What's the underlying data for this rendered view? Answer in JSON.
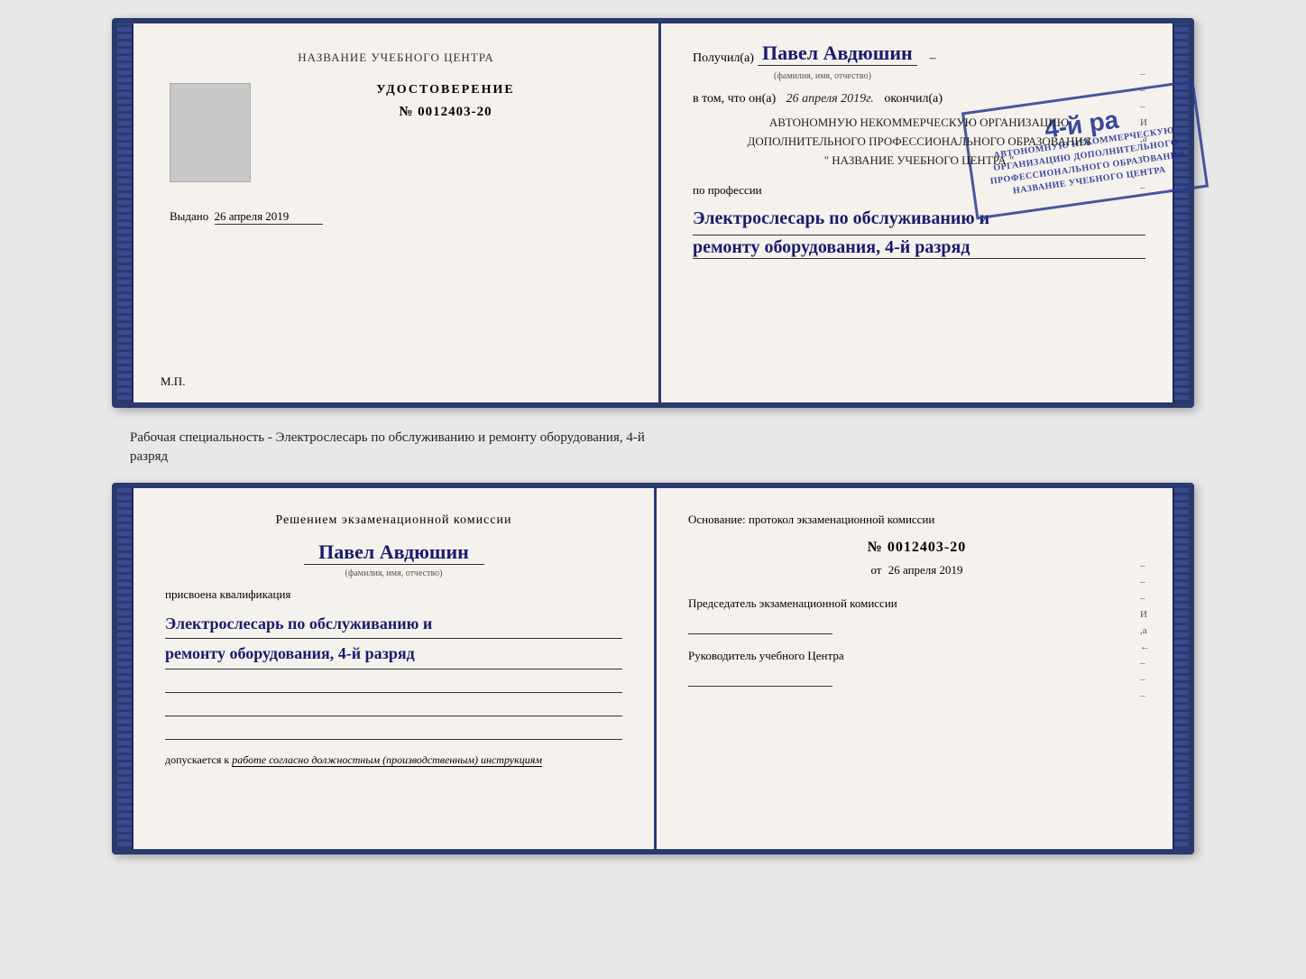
{
  "top_book": {
    "left_page": {
      "org_label": "НАЗВАНИЕ УЧЕБНОГО ЦЕНТРА",
      "doc_type": "УДОСТОВЕРЕНИЕ",
      "doc_number_prefix": "№",
      "doc_number": "0012403-20",
      "issued_label": "Выдано",
      "issued_date": "26 апреля 2019",
      "mp_label": "М.П."
    },
    "right_page": {
      "received_prefix": "Получил(а)",
      "recipient_name": "Павел Авдюшин",
      "fio_label": "(фамилия, имя, отчество)",
      "in_that_prefix": "в том, что он(а)",
      "completion_date": "26 апреля 2019г.",
      "completed_label": "окончил(а)",
      "org_line1": "АВТОНОМНУЮ НЕКОММЕРЧЕСКУЮ ОРГАНИЗАЦИЮ",
      "org_line2": "ДОПОЛНИТЕЛЬНОГО ПРОФЕССИОНАЛЬНОГО ОБРАЗОВАНИЯ",
      "org_name": "\" НАЗВАНИЕ УЧЕБНОГО ЦЕНТРА \"",
      "profession_prefix": "по профессии",
      "profession_line1": "Электрослесарь по обслуживанию и",
      "profession_line2": "ремонту оборудования, 4-й разряд",
      "stamp_big": "4-й ра",
      "stamp_line1": "АВТОНОМНУЮ НЕКОММЕРЧЕСКУЮ",
      "stamp_line2": "ОРГАНИЗАЦИЮ ДОПОЛНИТЕЛЬНОГО",
      "stamp_line3": "ПРОФЕССИОНАЛЬНОГО ОБРАЗОВАНИЯ",
      "stamp_line4": "НАЗВАНИЕ УЧЕБНОГО ЦЕНТРА"
    }
  },
  "between_label": {
    "line1": "Рабочая специальность - Электрослесарь по обслуживанию и ремонту оборудования, 4-й",
    "line2": "разряд"
  },
  "bottom_book": {
    "left_page": {
      "decision_label": "Решением экзаменационной комиссии",
      "person_name": "Павел Авдюшин",
      "fio_label": "(фамилия, имя, отчество)",
      "assigned_label": "присвоена квалификация",
      "qual_line1": "Электрослесарь по обслуживанию и",
      "qual_line2": "ремонту оборудования, 4-й разряд",
      "allowed_prefix": "допускается к",
      "allowed_text": "работе согласно должностным (производственным) инструкциям"
    },
    "right_page": {
      "basis_label": "Основание: протокол экзаменационной комиссии",
      "number_prefix": "№",
      "protocol_number": "0012403-20",
      "from_prefix": "от",
      "from_date": "26 апреля 2019",
      "chairman_label": "Председатель экзаменационной комиссии",
      "leader_label": "Руководитель учебного Центра"
    },
    "right_marks": [
      "И",
      "а",
      "←",
      "–",
      "–",
      "–",
      "–",
      "–"
    ]
  }
}
